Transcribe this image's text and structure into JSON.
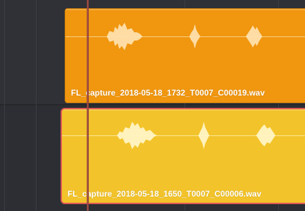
{
  "timeline": {
    "clips": [
      {
        "name": "FL_capture_2018-05-18_1732_T0007_C00019.wav",
        "color": "#f0960f",
        "selected": false
      },
      {
        "name": "FL_capture_2018-05-18_1650_T0007_C00006.wav",
        "color": "#f2c32a",
        "selected": true
      }
    ],
    "selection_color": "#e05a58",
    "playhead_color": "#8a3f3a"
  }
}
